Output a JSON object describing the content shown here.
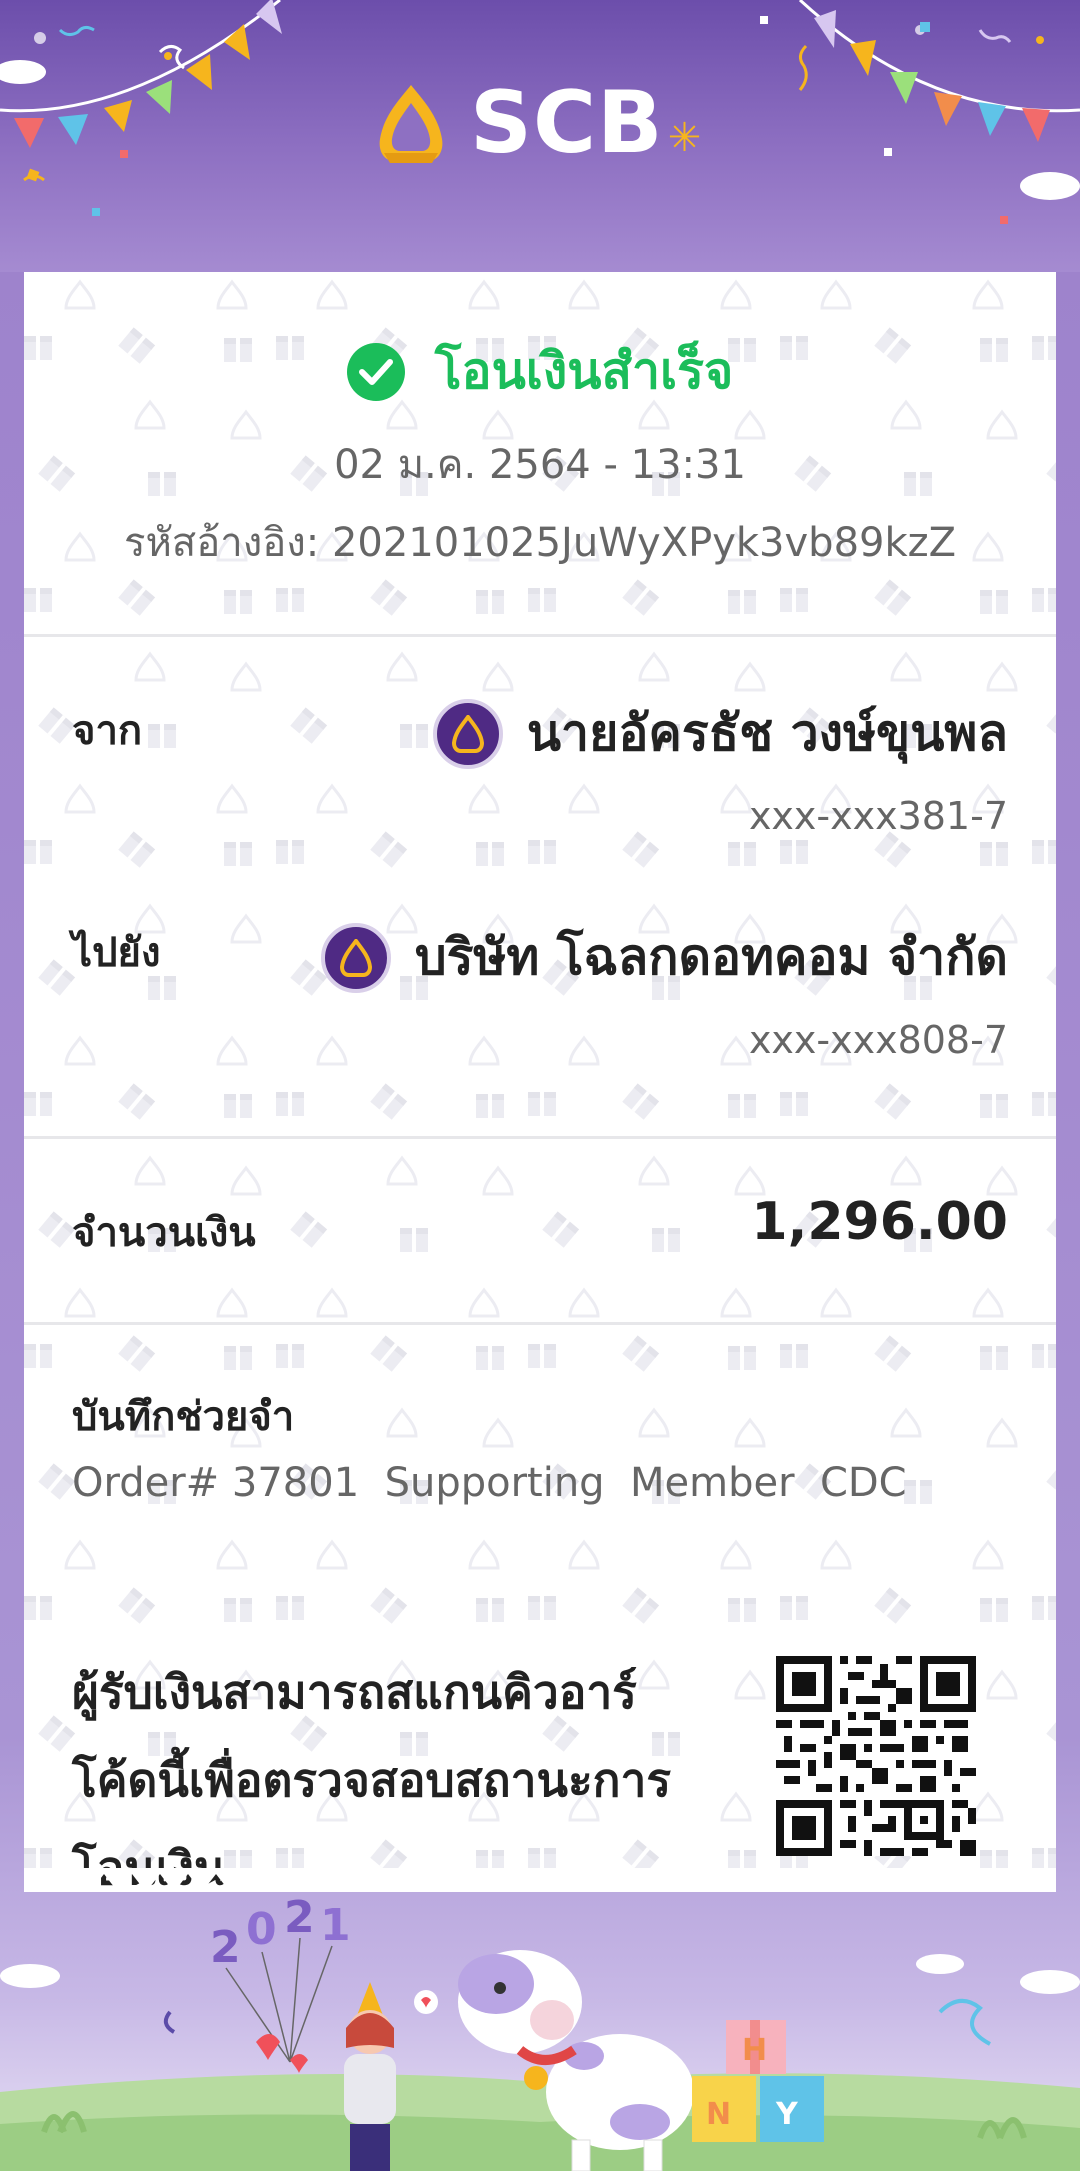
{
  "header": {
    "brand": "SCB",
    "brand_color": "#ffffff",
    "accent_gold": "#f6b51d",
    "background": "#7a5cb5"
  },
  "status": {
    "icon": "check-circle-icon",
    "title": "โอนเงินสำเร็จ",
    "color": "#1bbd5a",
    "datetime": "02 ม.ค. 2564 - 13:31",
    "reference": "รหัสอ้างอิง: 202101025JuWyXPyk3vb89kzZ"
  },
  "transfer": {
    "from": {
      "label": "จาก",
      "bank_icon": "scb-bank-icon",
      "name": "นายอัครธัช วงษ์ขุนพล",
      "account": "xxx-xxx381-7"
    },
    "to": {
      "label": "ไปยัง",
      "bank_icon": "scb-bank-icon",
      "name": "บริษัท โฉลกดอทคอม จำกัด",
      "account": "xxx-xxx808-7"
    }
  },
  "amount": {
    "label": "จำนวนเงิน",
    "value": "1,296.00"
  },
  "memo": {
    "label": "บันทึกช่วยจำ",
    "text": "Order# 37801  Supporting  Member  CDC"
  },
  "qr": {
    "line1": "ผู้รับเงินสามารถสแกนคิวอาร์",
    "line2": "โค้ดนี้เพื่อตรวจสอบสถานะการ",
    "line3": "โอนเงิน"
  },
  "footer": {
    "year_balloons": "2021",
    "gift_letters": [
      "H",
      "N",
      "Y"
    ]
  }
}
